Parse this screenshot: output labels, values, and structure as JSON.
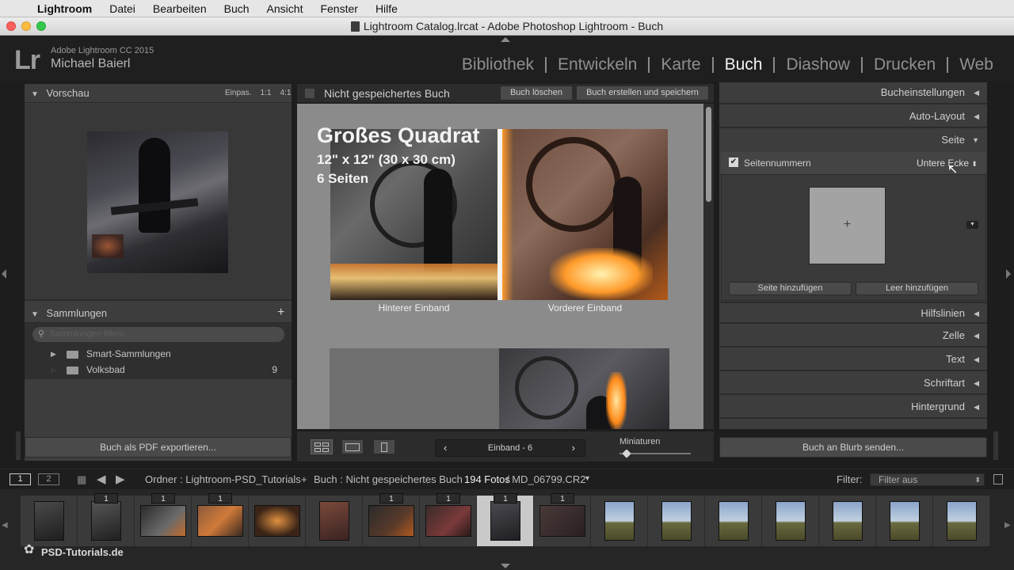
{
  "menubar": {
    "app": "Lightroom",
    "items": [
      "Datei",
      "Bearbeiten",
      "Buch",
      "Ansicht",
      "Fenster",
      "Hilfe"
    ]
  },
  "window": {
    "title": "Lightroom Catalog.lrcat - Adobe Photoshop Lightroom - Buch"
  },
  "identity": {
    "logo": "Lr",
    "version": "Adobe Lightroom CC 2015",
    "user": "Michael Baierl"
  },
  "modules": [
    "Bibliothek",
    "Entwickeln",
    "Karte",
    "Buch",
    "Diashow",
    "Drucken",
    "Web"
  ],
  "active_module": "Buch",
  "left_panel": {
    "preview": {
      "title": "Vorschau",
      "zoom_options": [
        "Einpas.",
        "1:1",
        "4:1"
      ]
    },
    "collections": {
      "title": "Sammlungen",
      "add_icon": "plus-icon",
      "search_placeholder": "Sammlungen filtern",
      "items": [
        {
          "label": "Smart-Sammlungen",
          "count": ""
        },
        {
          "label": "Volksbad",
          "count": "9"
        }
      ]
    },
    "export_button": "Buch als PDF exportieren..."
  },
  "center": {
    "book_name": "Nicht gespeichertes Buch",
    "delete_button": "Buch löschen",
    "save_button": "Buch erstellen und speichern",
    "overlay": {
      "title": "Großes Quadrat",
      "size": "12\" x 12\" (30 x 30 cm)",
      "pages": "6 Seiten"
    },
    "labels": {
      "back_cover": "Hinterer Einband",
      "front_cover": "Vorderer Einband"
    },
    "toolbar": {
      "page_nav": "Einband - 6",
      "thumbnails_label": "Miniaturen",
      "thumb_slider_value": 0.1
    }
  },
  "right_panel": {
    "sections_top": [
      "Bucheinstellungen",
      "Auto-Layout",
      "Seite"
    ],
    "page": {
      "page_numbers_label": "Seitennummern",
      "page_numbers_checked": true,
      "position": "Untere Ecke",
      "add_page_button": "Seite hinzufügen",
      "add_blank_button": "Leer hinzufügen"
    },
    "sections_bottom": [
      "Hilfslinien",
      "Zelle",
      "Text",
      "Schriftart",
      "Hintergrund"
    ],
    "blurb_button": "Buch an Blurb senden..."
  },
  "filmstrip_bar": {
    "screen_buttons": [
      "1",
      "2"
    ],
    "path": "Ordner : Lightroom-PSD_Tutorials",
    "separator": "+",
    "book": "Buch : Nicht gespeichertes Buch",
    "count": "194 Fotos",
    "file": "/ MD_06799.CR2",
    "filter_label": "Filter:",
    "filter_value": "Filter aus"
  },
  "filmstrip": {
    "badges": [
      "1",
      "1",
      "1",
      "1",
      "1",
      "1",
      "1"
    ],
    "watermark": "PSD-Tutorials.de"
  },
  "colors": {
    "accent": "#f2f2f2",
    "panel": "#3d3d3d",
    "background": "#1d1d1d"
  }
}
